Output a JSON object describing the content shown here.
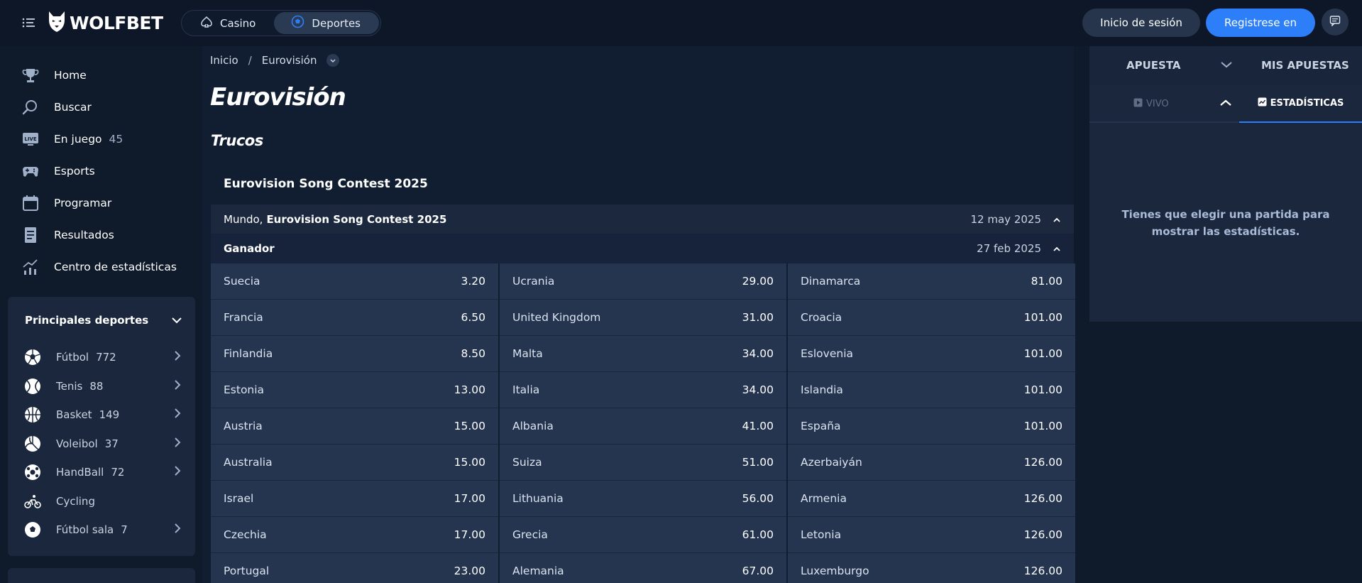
{
  "header": {
    "brand": "WOLFBET",
    "tabs": [
      {
        "label": "Casino",
        "active": false
      },
      {
        "label": "Deportes",
        "active": true
      }
    ],
    "login_label": "Inicio de sesión",
    "register_label": "Registrese en"
  },
  "sidebar": {
    "items": [
      {
        "label": "Home",
        "icon": "trophy-icon"
      },
      {
        "label": "Buscar",
        "icon": "search-icon"
      },
      {
        "label": "En juego",
        "count": "45",
        "icon": "live-icon"
      },
      {
        "label": "Esports",
        "icon": "gamepad-icon"
      },
      {
        "label": "Programar",
        "icon": "calendar-icon"
      },
      {
        "label": "Resultados",
        "icon": "results-icon"
      },
      {
        "label": "Centro de estadísticas",
        "icon": "stats-chart-icon"
      }
    ],
    "sports_title": "Principales deportes",
    "sports": [
      {
        "label": "Fútbol",
        "count": "772",
        "icon": "football-icon"
      },
      {
        "label": "Tenis",
        "count": "88",
        "icon": "tennis-icon"
      },
      {
        "label": "Basket",
        "count": "149",
        "icon": "basketball-icon"
      },
      {
        "label": "Voleibol",
        "count": "37",
        "icon": "volleyball-icon"
      },
      {
        "label": "HandBall",
        "count": "72",
        "icon": "handball-icon"
      },
      {
        "label": "Cycling",
        "count": "",
        "icon": "cycling-icon"
      },
      {
        "label": "Fútbol sala",
        "count": "7",
        "icon": "futsal-icon"
      }
    ]
  },
  "main": {
    "breadcrumb": [
      "Inicio",
      "/",
      "Eurovisión"
    ],
    "title": "Eurovisión",
    "section": "Trucos",
    "event_title": "Eurovision Song Contest 2025",
    "competition": {
      "region": "Mundo,",
      "name": "Eurovision Song Contest 2025",
      "date": "12 may 2025"
    },
    "market": {
      "name": "Ganador",
      "date": "27 feb 2025"
    },
    "odds": [
      [
        {
          "name": "Suecia",
          "price": "3.20"
        },
        {
          "name": "Ucrania",
          "price": "29.00"
        },
        {
          "name": "Dinamarca",
          "price": "81.00"
        }
      ],
      [
        {
          "name": "Francia",
          "price": "6.50"
        },
        {
          "name": "United Kingdom",
          "price": "31.00"
        },
        {
          "name": "Croacia",
          "price": "101.00"
        }
      ],
      [
        {
          "name": "Finlandia",
          "price": "8.50"
        },
        {
          "name": "Malta",
          "price": "34.00"
        },
        {
          "name": "Eslovenia",
          "price": "101.00"
        }
      ],
      [
        {
          "name": "Estonia",
          "price": "13.00"
        },
        {
          "name": "Italia",
          "price": "34.00"
        },
        {
          "name": "Islandia",
          "price": "101.00"
        }
      ],
      [
        {
          "name": "Austria",
          "price": "15.00"
        },
        {
          "name": "Albania",
          "price": "41.00"
        },
        {
          "name": "España",
          "price": "101.00"
        }
      ],
      [
        {
          "name": "Australia",
          "price": "15.00"
        },
        {
          "name": "Suiza",
          "price": "51.00"
        },
        {
          "name": "Azerbaiyán",
          "price": "126.00"
        }
      ],
      [
        {
          "name": "Israel",
          "price": "17.00"
        },
        {
          "name": "Lithuania",
          "price": "56.00"
        },
        {
          "name": "Armenia",
          "price": "126.00"
        }
      ],
      [
        {
          "name": "Czechia",
          "price": "17.00"
        },
        {
          "name": "Grecia",
          "price": "61.00"
        },
        {
          "name": "Letonia",
          "price": "126.00"
        }
      ],
      [
        {
          "name": "Portugal",
          "price": "23.00"
        },
        {
          "name": "Alemania",
          "price": "67.00"
        },
        {
          "name": "Luxemburgo",
          "price": "126.00"
        }
      ]
    ]
  },
  "betslip": {
    "tab_bet": "APUESTA",
    "tab_my_bets": "MIS APUESTAS",
    "tab_live": "VIVO",
    "tab_stats": "ESTADÍSTICAS",
    "stats_message": "Tienes que elegir una partida para mostrar las estadísticas."
  },
  "colors": {
    "background": "#0f1a2b",
    "accent": "#2d7ff9",
    "odds_cell": "#253550"
  }
}
